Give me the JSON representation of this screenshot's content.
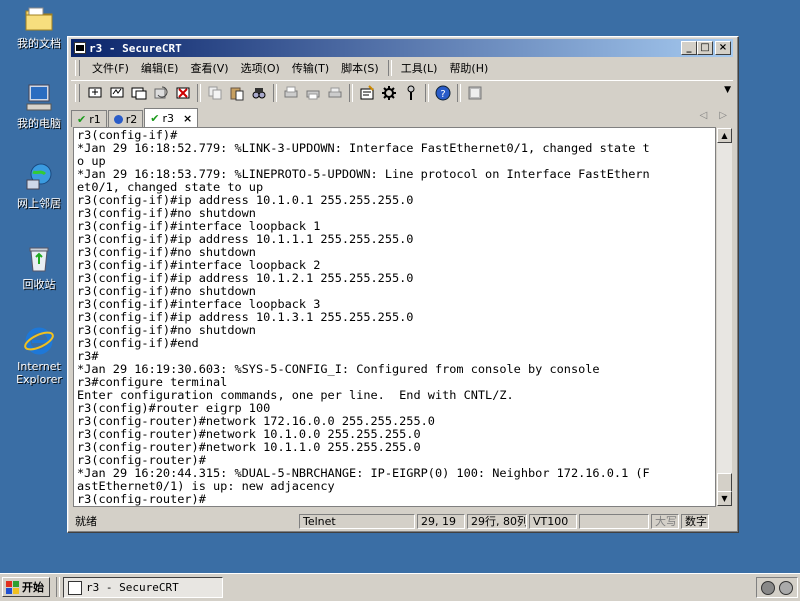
{
  "desktop": {
    "icons": [
      {
        "label": "我的文档"
      },
      {
        "label": "我的电脑"
      },
      {
        "label": "网上邻居"
      },
      {
        "label": "回收站"
      },
      {
        "label": "Internet Explorer"
      }
    ]
  },
  "window": {
    "title": "r3 - SecureCRT",
    "controls": {
      "minimize": "_",
      "maximize": "□",
      "close": "×"
    }
  },
  "menu": [
    "文件(F)",
    "编辑(E)",
    "查看(V)",
    "选项(O)",
    "传输(T)",
    "脚本(S)",
    "工具(L)",
    "帮助(H)"
  ],
  "tabs": [
    {
      "label": "r1",
      "status": "connected"
    },
    {
      "label": "r2",
      "status": "disconnected"
    },
    {
      "label": "r3",
      "status": "connected",
      "active": true,
      "close": "×"
    }
  ],
  "terminal": {
    "lines": [
      "r3(config-if)#",
      "*Jan 29 16:18:52.779: %LINK-3-UPDOWN: Interface FastEthernet0/1, changed state t",
      "o up",
      "*Jan 29 16:18:53.779: %LINEPROTO-5-UPDOWN: Line protocol on Interface FastEthern",
      "et0/1, changed state to up",
      "r3(config-if)#ip address 10.1.0.1 255.255.255.0",
      "r3(config-if)#no shutdown",
      "r3(config-if)#interface loopback 1",
      "r3(config-if)#ip address 10.1.1.1 255.255.255.0",
      "r3(config-if)#no shutdown",
      "r3(config-if)#interface loopback 2",
      "r3(config-if)#ip address 10.1.2.1 255.255.255.0",
      "r3(config-if)#no shutdown",
      "r3(config-if)#interface loopback 3",
      "r3(config-if)#ip address 10.1.3.1 255.255.255.0",
      "r3(config-if)#no shutdown",
      "r3(config-if)#end",
      "r3#",
      "*Jan 29 16:19:30.603: %SYS-5-CONFIG_I: Configured from console by console",
      "r3#configure terminal",
      "Enter configuration commands, one per line.  End with CNTL/Z.",
      "r3(config)#router eigrp 100",
      "r3(config-router)#network 172.16.0.0 255.255.255.0",
      "r3(config-router)#network 10.1.0.0 255.255.255.0",
      "r3(config-router)#network 10.1.1.0 255.255.255.0",
      "r3(config-router)#",
      "*Jan 29 16:20:44.315: %DUAL-5-NBRCHANGE: IP-EIGRP(0) 100: Neighbor 172.16.0.1 (F",
      "astEthernet0/1) is up: new adjacency",
      "r3(config-router)#"
    ]
  },
  "statusbar": {
    "ready": "就绪",
    "protocol": "Telnet",
    "cursor": "29, 19",
    "size": "29行, 80列",
    "emulation": "VT100",
    "empty": "",
    "caps": "大写",
    "num": "数字"
  },
  "taskbar": {
    "start": "开始",
    "task": "r3 - SecureCRT"
  }
}
